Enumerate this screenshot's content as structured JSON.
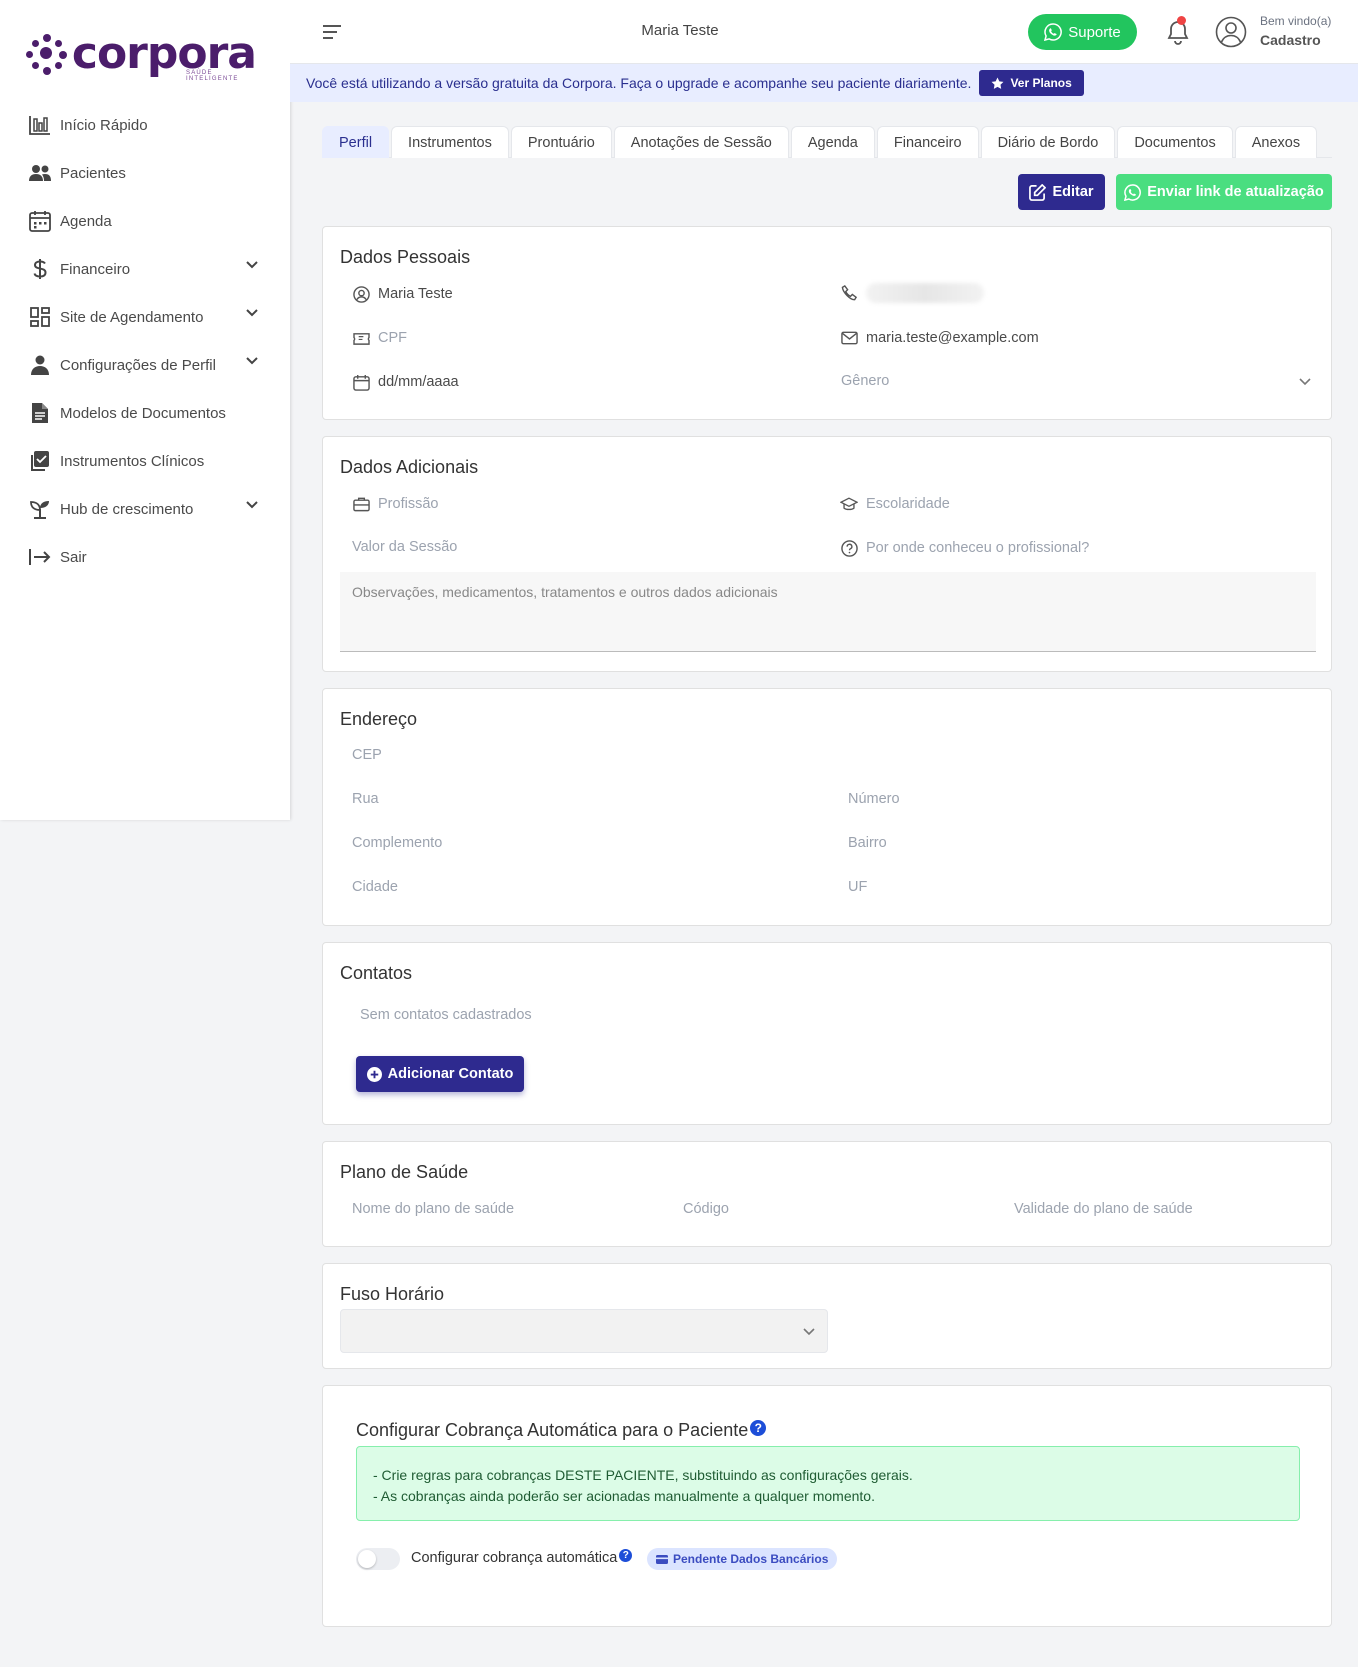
{
  "logo": {
    "name": "corpora",
    "tagline": "SAÚDE INTELIGENTE"
  },
  "sidebar": {
    "items": [
      {
        "label": "Início Rápido",
        "icon": "chart-bar-icon"
      },
      {
        "label": "Pacientes",
        "icon": "users-icon"
      },
      {
        "label": "Agenda",
        "icon": "calendar-icon"
      },
      {
        "label": "Financeiro",
        "icon": "dollar-icon",
        "expandable": true
      },
      {
        "label": "Site de Agendamento",
        "icon": "grid-icon",
        "expandable": true
      },
      {
        "label": "Configurações de Perfil",
        "icon": "user-icon",
        "expandable": true
      },
      {
        "label": "Modelos de Documentos",
        "icon": "document-icon"
      },
      {
        "label": "Instrumentos Clínicos",
        "icon": "clipboard-icon"
      },
      {
        "label": "Hub de crescimento",
        "icon": "sprout-icon",
        "expandable": true
      },
      {
        "label": "Sair",
        "icon": "logout-icon"
      }
    ]
  },
  "header": {
    "patient_name": "Maria Teste",
    "support_label": "Suporte",
    "welcome": "Bem vindo(a)",
    "user_label": "Cadastro"
  },
  "banner": {
    "text": "Você está utilizando a versão gratuita da Corpora. Faça o upgrade e acompanhe seu paciente diariamente.",
    "button": "Ver Planos"
  },
  "tabs": [
    "Perfil",
    "Instrumentos",
    "Prontuário",
    "Anotações de Sessão",
    "Agenda",
    "Financeiro",
    "Diário de Bordo",
    "Documentos",
    "Anexos"
  ],
  "actions": {
    "edit": "Editar",
    "send_link": "Enviar link de atualização"
  },
  "dados_pessoais": {
    "title": "Dados Pessoais",
    "name": "Maria Teste",
    "cpf_placeholder": "CPF",
    "email": "maria.teste@example.com",
    "birth_placeholder": "dd/mm/aaaa",
    "gender_placeholder": "Gênero"
  },
  "dados_adicionais": {
    "title": "Dados Adicionais",
    "profissao": "Profissão",
    "escolaridade": "Escolaridade",
    "valor_sessao": "Valor da Sessão",
    "origem": "Por onde conheceu o profissional?",
    "observacoes": "Observações, medicamentos, tratamentos e outros dados adicionais"
  },
  "endereco": {
    "title": "Endereço",
    "cep": "CEP",
    "rua": "Rua",
    "numero": "Número",
    "complemento": "Complemento",
    "bairro": "Bairro",
    "cidade": "Cidade",
    "uf": "UF"
  },
  "contatos": {
    "title": "Contatos",
    "empty": "Sem contatos cadastrados",
    "add_button": "Adicionar Contato"
  },
  "plano_saude": {
    "title": "Plano de Saúde",
    "nome": "Nome do plano de saúde",
    "codigo": "Código",
    "validade": "Validade do plano de saúde"
  },
  "fuso": {
    "title": "Fuso Horário"
  },
  "cobranca": {
    "title": "Configurar Cobrança Automática para o Paciente",
    "info_line1": "- Crie regras para cobranças DESTE PACIENTE, substituindo as configurações gerais.",
    "info_line2": "- As cobranças ainda poderão ser acionadas manualmente a qualquer momento.",
    "toggle_label": "Configurar cobrança automática",
    "help": "?",
    "status_pill": "Pendente Dados Bancários"
  },
  "colors": {
    "primary": "#2e2a8f",
    "success": "#22c55e",
    "brand": "#4b1d6b"
  }
}
